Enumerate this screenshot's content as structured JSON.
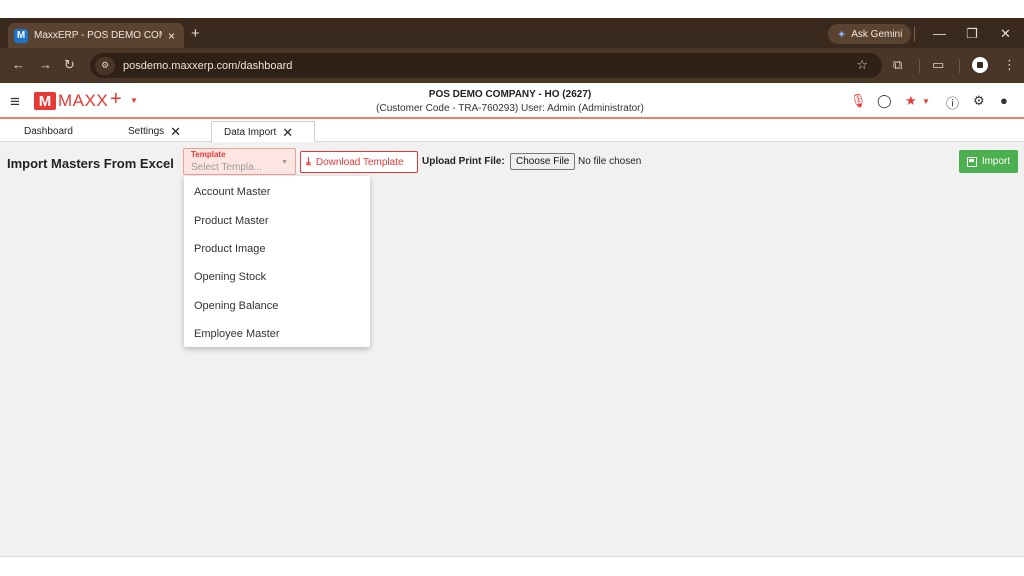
{
  "browser": {
    "tab_title": "MaxxERP - POS DEMO COMPANY",
    "favicon_letter": "M",
    "tab_close": "×",
    "new_tab": "+",
    "gemini_label": "Ask Gemini",
    "url": "posdemo.maxxerp.com/dashboard",
    "icons": [
      "back-icon",
      "forward-icon",
      "reload-icon",
      "site-settings-icon",
      "star-icon",
      "extensions-icon",
      "reading-mode-icon",
      "record-icon",
      "menu-dots-icon"
    ]
  },
  "app": {
    "logo_letter": "M",
    "logo_text": "MAXX",
    "plus": "+",
    "company": "POS DEMO COMPANY - HO (2627)",
    "customer_info": "(Customer Code - TRA-760293) User: Admin (Administrator)",
    "accent": "#e53935"
  },
  "page_tabs": [
    {
      "label": "Dashboard",
      "closable": false
    },
    {
      "label": "Settings",
      "closable": true
    },
    {
      "label": "Data Import",
      "closable": true,
      "active": true
    }
  ],
  "main": {
    "title": "Import Masters From Excel",
    "template_label": "Template",
    "template_placeholder": "Select Templa...",
    "download_label": "Download Template",
    "upload_label": "Upload Print File:",
    "choose_file": "Choose File",
    "no_file": "No file chosen",
    "import_label": "Import"
  },
  "dropdown": {
    "options": [
      "Account Master",
      "Product Master",
      "Product Image",
      "Opening Stock",
      "Opening Balance",
      "Employee Master"
    ]
  }
}
